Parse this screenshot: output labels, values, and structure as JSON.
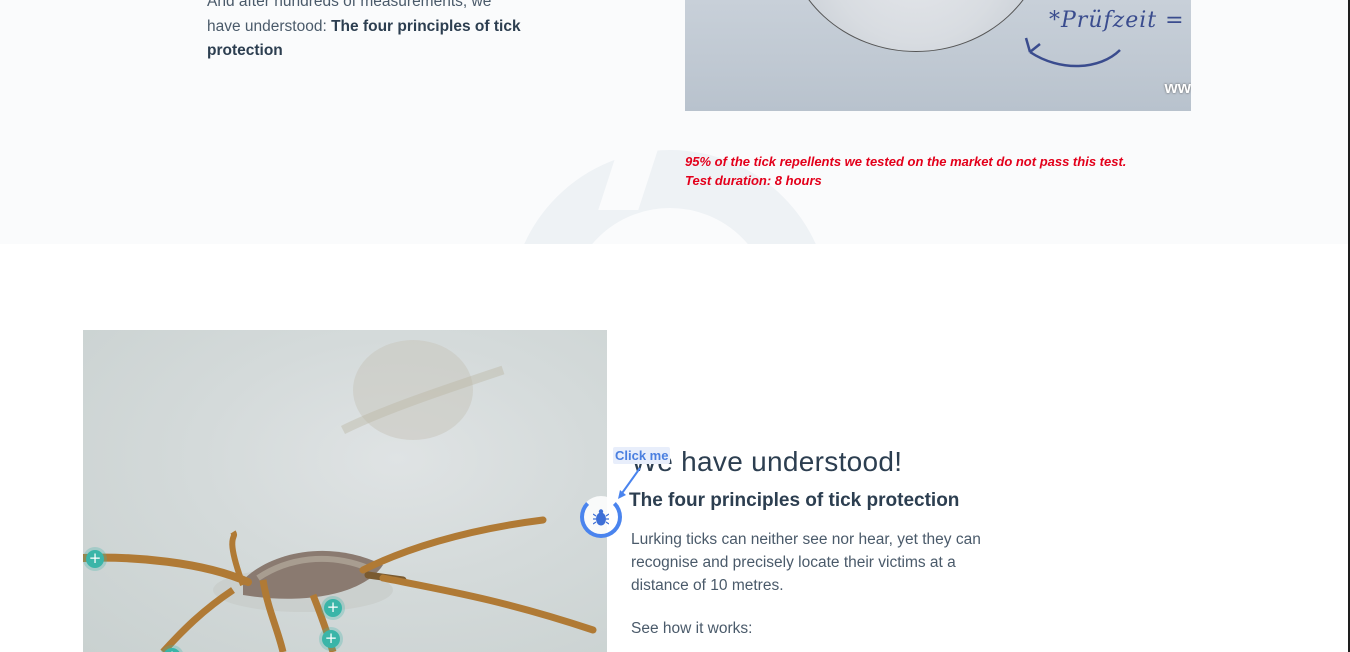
{
  "intro": {
    "partial_line": "And after hundreds of measurements, we",
    "line2": "have understood: ",
    "bold": "The four principles of tick protection"
  },
  "test_image": {
    "handwriting": "*Prüfzeit =",
    "watermark": "ww"
  },
  "test_note": {
    "line1": "95% of the tick repellents we tested on the market do not pass this test.",
    "line2": "Test duration: 8 hours"
  },
  "section": {
    "title": "We have understood!",
    "subtitle": "The four principles of tick protection",
    "body": "Lurking ticks can neither see nor hear, yet they can recognise and precisely locate their victims at a distance of 10 metres.",
    "see_how": "See how it works:"
  },
  "widget": {
    "click_me_label": "Click me"
  },
  "hotspot_symbol": "+",
  "colors": {
    "accent_red": "#e3001b",
    "text_dark": "#2c3e50",
    "hotspot_teal": "#3ab5a8",
    "widget_blue": "#4a84ee"
  }
}
